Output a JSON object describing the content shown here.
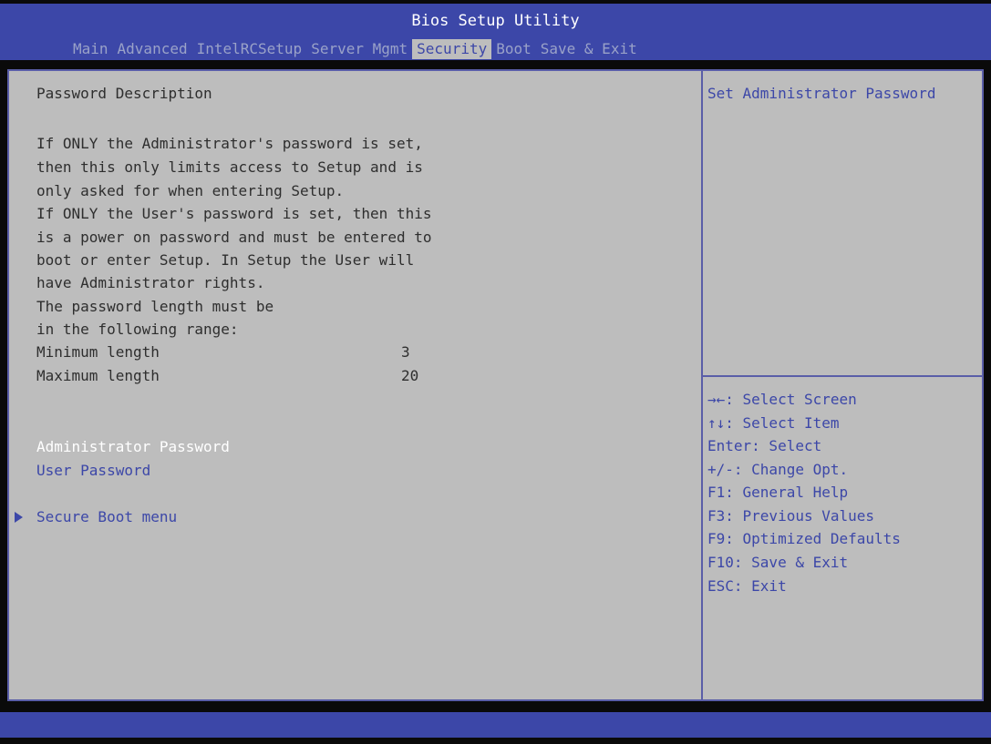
{
  "app": {
    "title": "Bios Setup Utility"
  },
  "tabs": [
    {
      "label": "Main"
    },
    {
      "label": "Advanced"
    },
    {
      "label": "IntelRCSetup"
    },
    {
      "label": "Server Mgmt"
    },
    {
      "label": "Security",
      "active": true
    },
    {
      "label": "Boot"
    },
    {
      "label": "Save & Exit"
    }
  ],
  "main": {
    "description_title": "Password Description",
    "description_lines": [
      "If ONLY the Administrator's password is set,",
      "then this only limits access to Setup and is",
      "only asked for when entering Setup.",
      "If ONLY the User's password is set, then this",
      "is a power on password and must be entered to",
      "boot or enter Setup. In Setup the User will",
      "have Administrator rights.",
      "The password length must be",
      "in the following range:"
    ],
    "min_length": {
      "label": "Minimum length",
      "value": "3"
    },
    "max_length": {
      "label": "Maximum length",
      "value": "20"
    },
    "items": {
      "admin_password": "Administrator Password",
      "user_password": "User Password",
      "secure_boot_menu": "Secure Boot menu"
    }
  },
  "help": {
    "item_help": "Set Administrator Password",
    "keys": [
      "→←: Select Screen",
      "↑↓: Select Item",
      "Enter: Select",
      "+/-: Change Opt.",
      "F1: General Help",
      "F3: Previous Values",
      "F9: Optimized Defaults",
      "F10: Save & Exit",
      "ESC: Exit"
    ]
  },
  "colors": {
    "header_bg": "#3c47a8",
    "panel_bg": "#bdbdbd",
    "accent_blue": "#3c47a8",
    "selected_text": "#ffffff"
  }
}
